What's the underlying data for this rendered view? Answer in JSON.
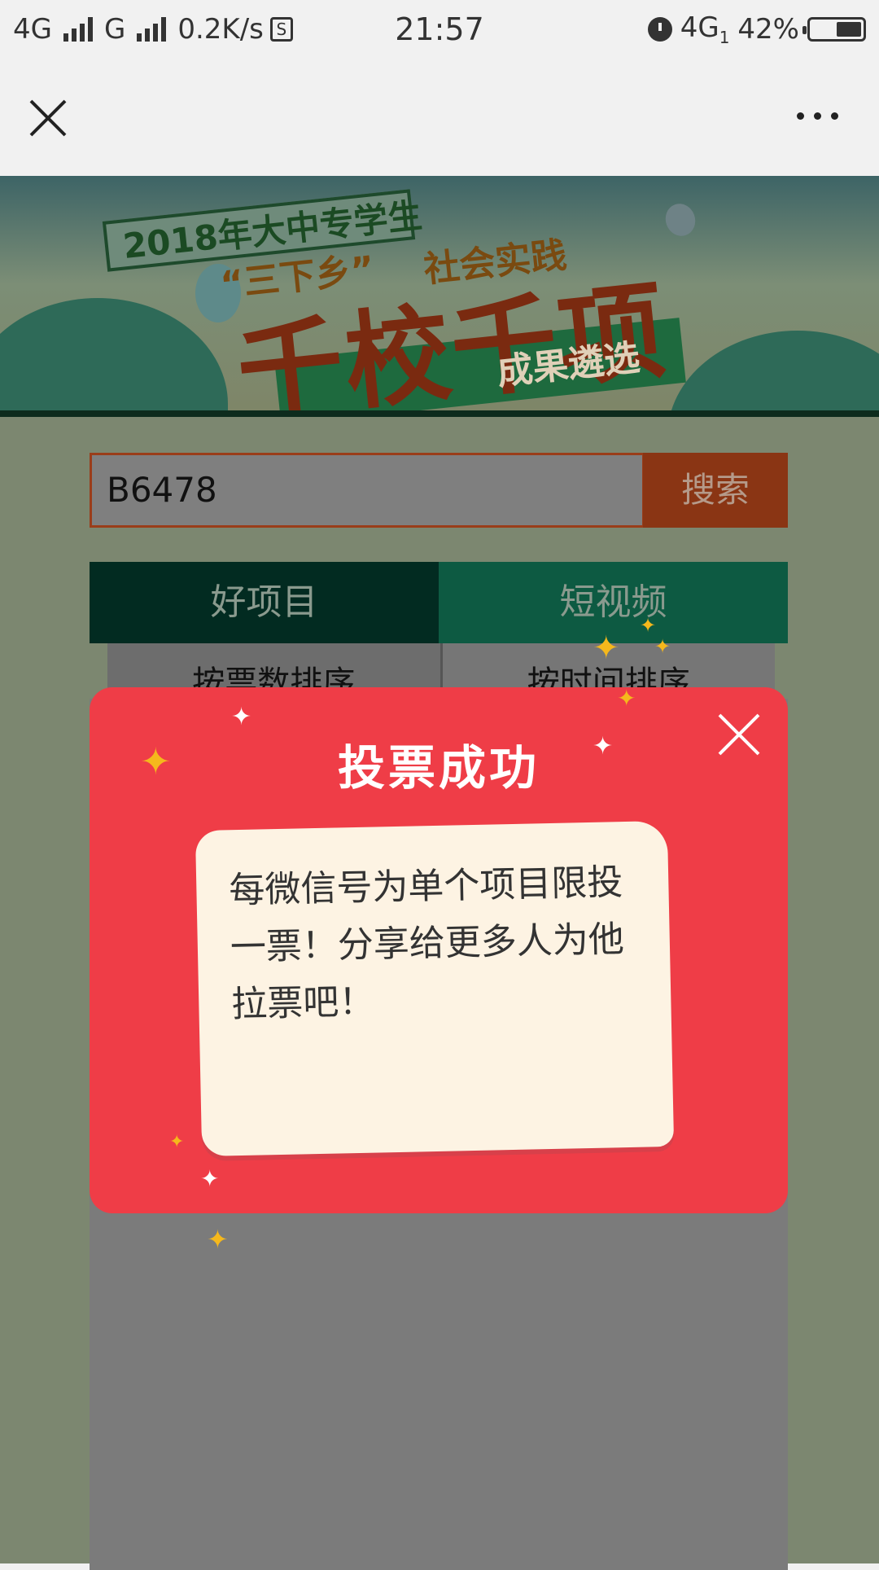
{
  "status_bar": {
    "network1": "4G",
    "network2": "G",
    "speed": "0.2K/s",
    "s_icon": "S",
    "time": "21:57",
    "network3": "4G",
    "network3_sub": "1",
    "battery": "42%"
  },
  "navbar": {
    "close_icon": "close-icon",
    "more_icon": "more-icon"
  },
  "banner": {
    "line1": "2018年大中专学生",
    "line2": "“三下乡”",
    "line3": "社会实践",
    "line4": "千校千项",
    "line5": "成果遴选"
  },
  "search": {
    "value": "B6478",
    "button_label": "搜索"
  },
  "tabs": [
    {
      "label": "好项目"
    },
    {
      "label": "短视频"
    }
  ],
  "sort": [
    {
      "label": "按票数排序"
    },
    {
      "label": "按时间排序"
    }
  ],
  "modal": {
    "title": "投票成功",
    "message": "每微信号为单个项目限投一票！分享给更多人为他拉票吧！"
  },
  "colors": {
    "modal_bg": "#ef3d47",
    "scroll_bg": "#fdf3e3",
    "search_button_bg": "#8a3514",
    "tab_good_bg": "#022b21",
    "tab_video_bg": "#0d5a42",
    "star": "#f5b81c"
  }
}
